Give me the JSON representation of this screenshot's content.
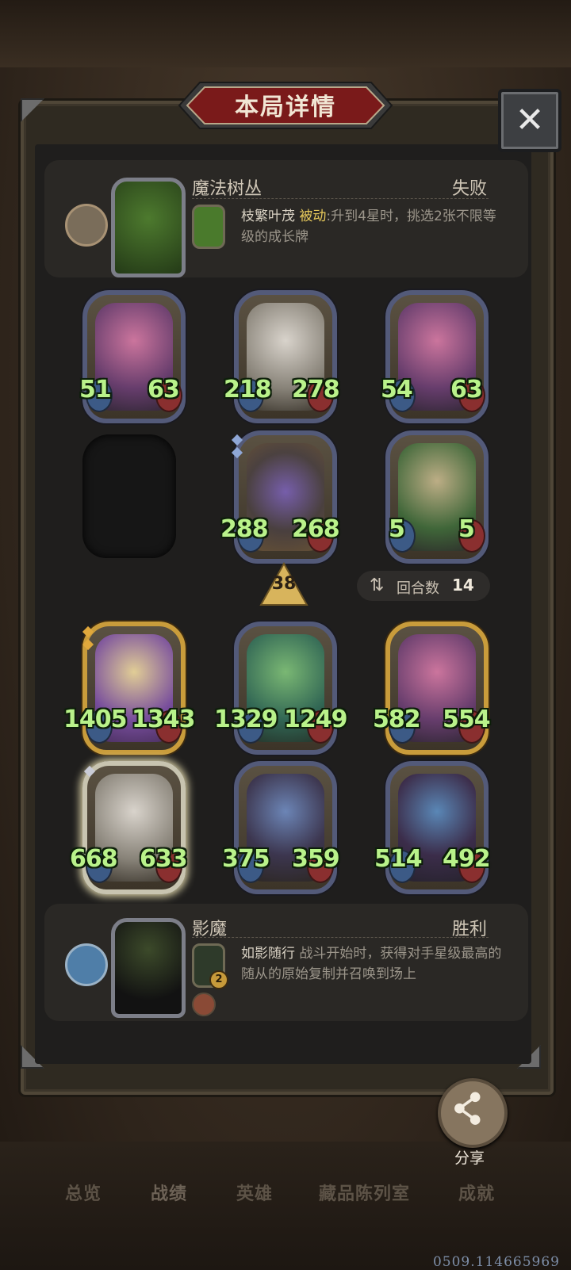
{
  "title": "本局详情",
  "close_icon": "close-icon",
  "opponent_top": {
    "name": "魔法树丛",
    "result": "失败",
    "skill_name": "枝繁叶茂",
    "skill_type": "被动",
    "skill_desc": ":升到4星时，挑选2张不限等级的成长牌"
  },
  "top_board": [
    {
      "atk": "51",
      "hp": "63"
    },
    {
      "atk": "218",
      "hp": "278"
    },
    {
      "atk": "54",
      "hp": "63"
    },
    {
      "atk": "",
      "hp": ""
    },
    {
      "atk": "288",
      "hp": "268"
    },
    {
      "atk": "5",
      "hp": "5"
    }
  ],
  "damage": "38",
  "rounds": {
    "label": "回合数",
    "value": "14"
  },
  "bottom_board": [
    {
      "atk": "1405",
      "hp": "1343"
    },
    {
      "atk": "1329",
      "hp": "1249"
    },
    {
      "atk": "582",
      "hp": "554"
    },
    {
      "atk": "668",
      "hp": "633"
    },
    {
      "atk": "375",
      "hp": "359"
    },
    {
      "atk": "514",
      "hp": "492"
    }
  ],
  "player_bottom": {
    "name": "影魔",
    "result": "胜利",
    "skill_name": "如影随行",
    "skill_desc": "战斗开始时，获得对手星级最高的随从的原始复制并召唤到场上",
    "badge": "2"
  },
  "share_label": "分享",
  "nav": [
    "总览",
    "战绩",
    "英雄",
    "藏品陈列室",
    "成就"
  ],
  "watermark": "0509.114665969",
  "colors": {
    "stat_green": "#b9f28a",
    "gold_frame": "#c99c3b",
    "title_red": "#7a1a1a"
  }
}
